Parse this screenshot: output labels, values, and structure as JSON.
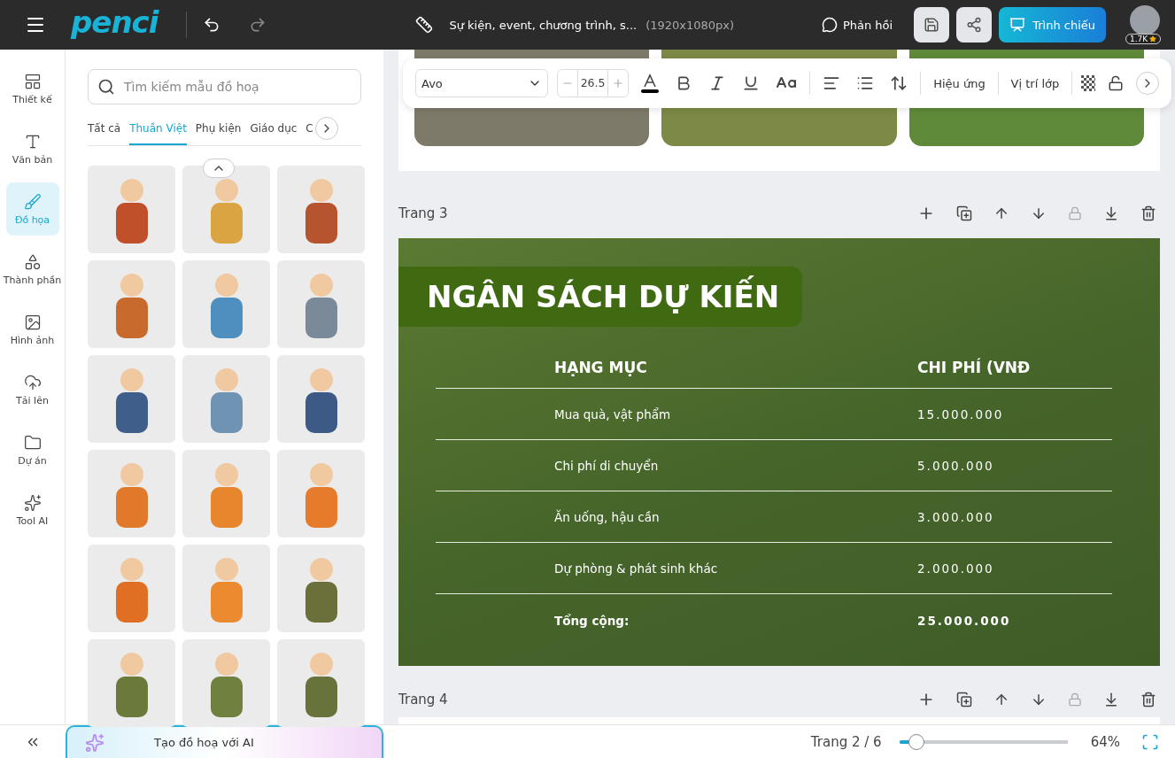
{
  "topbar": {
    "logo": "penci",
    "doc_title": "Sự kiện, event, chương trình, s...",
    "doc_size": "(1920x1080px)",
    "feedback": "Phản hồi",
    "present": "Trình chiếu",
    "badge": "1.7K"
  },
  "rail": [
    {
      "label": "Thiết kế",
      "selected": false
    },
    {
      "label": "Văn bản",
      "selected": false
    },
    {
      "label": "Đồ họa",
      "selected": true
    },
    {
      "label": "Thành phần",
      "selected": false
    },
    {
      "label": "Hình ảnh",
      "selected": false
    },
    {
      "label": "Tải lên",
      "selected": false
    },
    {
      "label": "Dự án",
      "selected": false
    },
    {
      "label": "Tool AI",
      "selected": false
    }
  ],
  "panel": {
    "search": {
      "placeholder": "Tìm kiếm mẫu đồ hoạ"
    },
    "tabs": [
      {
        "label": "Tất cả",
        "selected": false
      },
      {
        "label": "Thuần Việt",
        "selected": true
      },
      {
        "label": "Phụ kiện",
        "selected": false
      },
      {
        "label": "Giáo dục",
        "selected": false
      },
      {
        "label": "C",
        "selected": false
      }
    ],
    "graphics": [
      {
        "color": "#c0502a"
      },
      {
        "color": "#d9a441"
      },
      {
        "color": "#b5542e"
      },
      {
        "color": "#c86a2d"
      },
      {
        "color": "#4f8fc0"
      },
      {
        "color": "#7a8a99"
      },
      {
        "color": "#3f5f8a"
      },
      {
        "color": "#6f93b3"
      },
      {
        "color": "#3d5a86"
      },
      {
        "color": "#e07a2a"
      },
      {
        "color": "#e8862d"
      },
      {
        "color": "#e57b2b"
      },
      {
        "color": "#e06f24"
      },
      {
        "color": "#ec8a2f"
      },
      {
        "color": "#6b6f3a"
      },
      {
        "color": "#6b7a3b"
      },
      {
        "color": "#70803f"
      },
      {
        "color": "#67733a"
      }
    ],
    "ai_button": "Tạo đồ hoạ với AI"
  },
  "toolbar": {
    "font": "Avo",
    "font_size": "26.5",
    "effects": "Hiệu ứng",
    "layer": "Vị trí lớp"
  },
  "prev_page": {
    "photos": [
      {
        "color": "#7d7a6a"
      },
      {
        "color": "#7c8a45"
      },
      {
        "color": "#5f8a3a"
      }
    ]
  },
  "pages": [
    {
      "label": "Trang 3"
    },
    {
      "label": "Trang 4"
    }
  ],
  "slide": {
    "title": "NGÂN SÁCH DỰ KIẾN",
    "rows": [
      {
        "kind": "header",
        "item": "HẠNG MỤC",
        "cost": "CHI PHÍ (VNĐ"
      },
      {
        "kind": "item",
        "item": "Mua quà, vật phẩm",
        "cost": "15.000.000"
      },
      {
        "kind": "item",
        "item": "Chi phí di chuyển",
        "cost": "5.000.000"
      },
      {
        "kind": "item",
        "item": "Ăn uống, hậu cần",
        "cost": "3.000.000"
      },
      {
        "kind": "item",
        "item": "Dự phòng & phát sinh khác",
        "cost": "2.000.000"
      },
      {
        "kind": "total",
        "item": "Tổng cộng:",
        "cost": "25.000.000"
      }
    ]
  },
  "footer": {
    "page_indicator": "Trang 2 / 6",
    "zoom": {
      "level": 0.1
    },
    "zoom_label": "64%"
  }
}
